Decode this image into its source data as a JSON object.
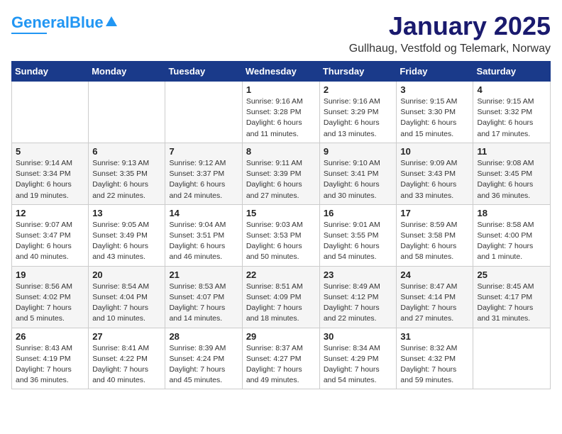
{
  "header": {
    "logo_general": "General",
    "logo_blue": "Blue",
    "month_title": "January 2025",
    "location": "Gullhaug, Vestfold og Telemark, Norway"
  },
  "weekdays": [
    "Sunday",
    "Monday",
    "Tuesday",
    "Wednesday",
    "Thursday",
    "Friday",
    "Saturday"
  ],
  "weeks": [
    [
      {
        "day": "",
        "info": ""
      },
      {
        "day": "",
        "info": ""
      },
      {
        "day": "",
        "info": ""
      },
      {
        "day": "1",
        "info": "Sunrise: 9:16 AM\nSunset: 3:28 PM\nDaylight: 6 hours\nand 11 minutes."
      },
      {
        "day": "2",
        "info": "Sunrise: 9:16 AM\nSunset: 3:29 PM\nDaylight: 6 hours\nand 13 minutes."
      },
      {
        "day": "3",
        "info": "Sunrise: 9:15 AM\nSunset: 3:30 PM\nDaylight: 6 hours\nand 15 minutes."
      },
      {
        "day": "4",
        "info": "Sunrise: 9:15 AM\nSunset: 3:32 PM\nDaylight: 6 hours\nand 17 minutes."
      }
    ],
    [
      {
        "day": "5",
        "info": "Sunrise: 9:14 AM\nSunset: 3:34 PM\nDaylight: 6 hours\nand 19 minutes."
      },
      {
        "day": "6",
        "info": "Sunrise: 9:13 AM\nSunset: 3:35 PM\nDaylight: 6 hours\nand 22 minutes."
      },
      {
        "day": "7",
        "info": "Sunrise: 9:12 AM\nSunset: 3:37 PM\nDaylight: 6 hours\nand 24 minutes."
      },
      {
        "day": "8",
        "info": "Sunrise: 9:11 AM\nSunset: 3:39 PM\nDaylight: 6 hours\nand 27 minutes."
      },
      {
        "day": "9",
        "info": "Sunrise: 9:10 AM\nSunset: 3:41 PM\nDaylight: 6 hours\nand 30 minutes."
      },
      {
        "day": "10",
        "info": "Sunrise: 9:09 AM\nSunset: 3:43 PM\nDaylight: 6 hours\nand 33 minutes."
      },
      {
        "day": "11",
        "info": "Sunrise: 9:08 AM\nSunset: 3:45 PM\nDaylight: 6 hours\nand 36 minutes."
      }
    ],
    [
      {
        "day": "12",
        "info": "Sunrise: 9:07 AM\nSunset: 3:47 PM\nDaylight: 6 hours\nand 40 minutes."
      },
      {
        "day": "13",
        "info": "Sunrise: 9:05 AM\nSunset: 3:49 PM\nDaylight: 6 hours\nand 43 minutes."
      },
      {
        "day": "14",
        "info": "Sunrise: 9:04 AM\nSunset: 3:51 PM\nDaylight: 6 hours\nand 46 minutes."
      },
      {
        "day": "15",
        "info": "Sunrise: 9:03 AM\nSunset: 3:53 PM\nDaylight: 6 hours\nand 50 minutes."
      },
      {
        "day": "16",
        "info": "Sunrise: 9:01 AM\nSunset: 3:55 PM\nDaylight: 6 hours\nand 54 minutes."
      },
      {
        "day": "17",
        "info": "Sunrise: 8:59 AM\nSunset: 3:58 PM\nDaylight: 6 hours\nand 58 minutes."
      },
      {
        "day": "18",
        "info": "Sunrise: 8:58 AM\nSunset: 4:00 PM\nDaylight: 7 hours\nand 1 minute."
      }
    ],
    [
      {
        "day": "19",
        "info": "Sunrise: 8:56 AM\nSunset: 4:02 PM\nDaylight: 7 hours\nand 5 minutes."
      },
      {
        "day": "20",
        "info": "Sunrise: 8:54 AM\nSunset: 4:04 PM\nDaylight: 7 hours\nand 10 minutes."
      },
      {
        "day": "21",
        "info": "Sunrise: 8:53 AM\nSunset: 4:07 PM\nDaylight: 7 hours\nand 14 minutes."
      },
      {
        "day": "22",
        "info": "Sunrise: 8:51 AM\nSunset: 4:09 PM\nDaylight: 7 hours\nand 18 minutes."
      },
      {
        "day": "23",
        "info": "Sunrise: 8:49 AM\nSunset: 4:12 PM\nDaylight: 7 hours\nand 22 minutes."
      },
      {
        "day": "24",
        "info": "Sunrise: 8:47 AM\nSunset: 4:14 PM\nDaylight: 7 hours\nand 27 minutes."
      },
      {
        "day": "25",
        "info": "Sunrise: 8:45 AM\nSunset: 4:17 PM\nDaylight: 7 hours\nand 31 minutes."
      }
    ],
    [
      {
        "day": "26",
        "info": "Sunrise: 8:43 AM\nSunset: 4:19 PM\nDaylight: 7 hours\nand 36 minutes."
      },
      {
        "day": "27",
        "info": "Sunrise: 8:41 AM\nSunset: 4:22 PM\nDaylight: 7 hours\nand 40 minutes."
      },
      {
        "day": "28",
        "info": "Sunrise: 8:39 AM\nSunset: 4:24 PM\nDaylight: 7 hours\nand 45 minutes."
      },
      {
        "day": "29",
        "info": "Sunrise: 8:37 AM\nSunset: 4:27 PM\nDaylight: 7 hours\nand 49 minutes."
      },
      {
        "day": "30",
        "info": "Sunrise: 8:34 AM\nSunset: 4:29 PM\nDaylight: 7 hours\nand 54 minutes."
      },
      {
        "day": "31",
        "info": "Sunrise: 8:32 AM\nSunset: 4:32 PM\nDaylight: 7 hours\nand 59 minutes."
      },
      {
        "day": "",
        "info": ""
      }
    ]
  ]
}
